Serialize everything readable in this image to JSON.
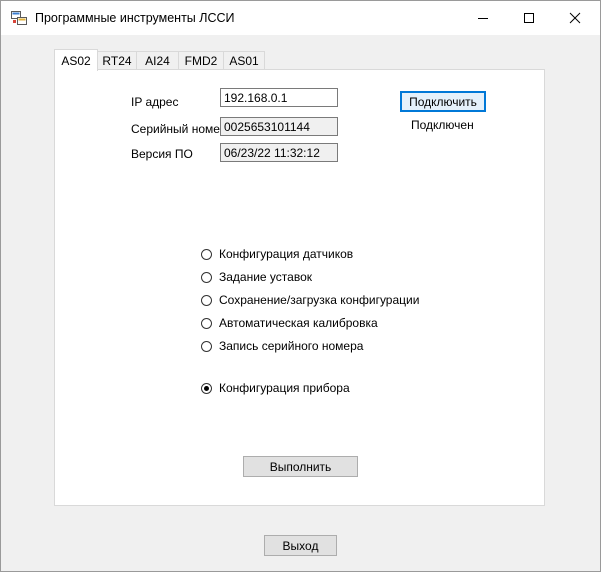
{
  "window": {
    "title": "Программные инструменты ЛССИ",
    "icon": "app-window-icon",
    "controls": [
      "minimize-icon",
      "maximize-icon",
      "close-icon"
    ]
  },
  "tabs": [
    {
      "label": "AS02",
      "active": true
    },
    {
      "label": "RT24",
      "active": false
    },
    {
      "label": "AI24",
      "active": false
    },
    {
      "label": "FMD2",
      "active": false
    },
    {
      "label": "AS01",
      "active": false
    }
  ],
  "connection": {
    "ip_label": "IP адрес",
    "ip_value": "192.168.0.1",
    "serial_label": "Серийный номер",
    "serial_value": "0025653101144",
    "version_label": "Версия ПО",
    "version_value": "06/23/22 11:32:12",
    "connect_button": "Подключить",
    "status": "Подключен"
  },
  "options": [
    {
      "label": "Конфигурация датчиков",
      "checked": false
    },
    {
      "label": "Задание уставок",
      "checked": false
    },
    {
      "label": "Сохранение/загрузка конфигурации",
      "checked": false
    },
    {
      "label": "Автоматическая калибровка",
      "checked": false
    },
    {
      "label": "Запись серийного номера",
      "checked": false
    },
    {
      "label": "Конфигурация прибора",
      "checked": true
    }
  ],
  "execute_button": "Выполнить",
  "exit_button": "Выход",
  "colors": {
    "accent": "#0078d7",
    "panel_background": "#ffffff",
    "window_background": "#f0f0f0"
  }
}
